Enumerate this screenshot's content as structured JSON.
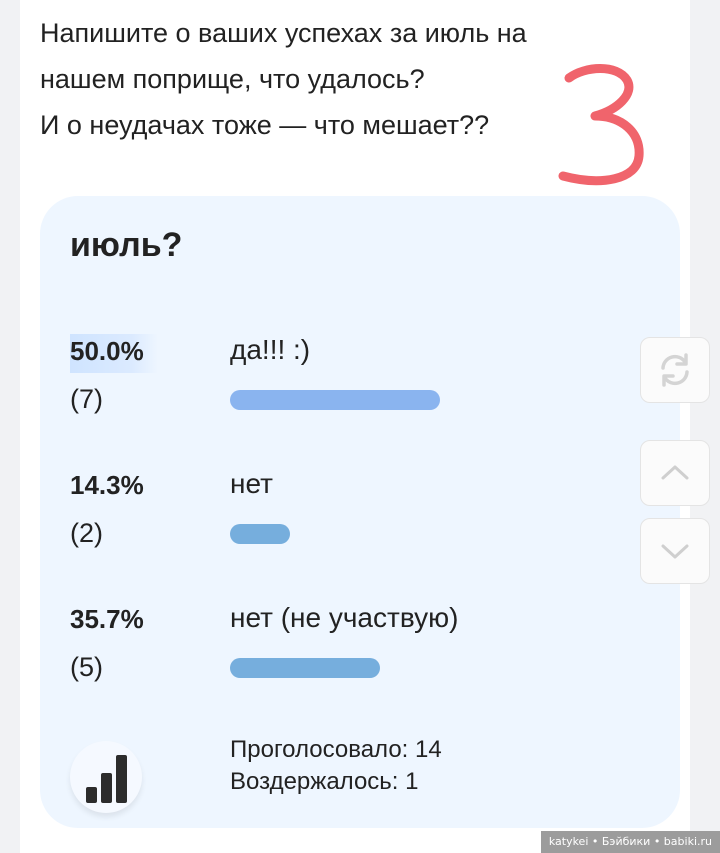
{
  "intro": {
    "lines": [
      "Напишите о ваших успехах за июль на",
      "нашем поприще, что удалось?",
      "И о неудачах тоже — что мешает??"
    ]
  },
  "handwritten_mark": "3",
  "poll": {
    "title": "июль?",
    "options": [
      {
        "percent": "50.0%",
        "count": "(7)",
        "label": "да!!! :)",
        "share": 0.5,
        "color": "#8ab4ef"
      },
      {
        "percent": "14.3%",
        "count": "(2)",
        "label": "нет",
        "share": 0.143,
        "color": "#76aedd"
      },
      {
        "percent": "35.7%",
        "count": "(5)",
        "label": "нет (не участвую)",
        "share": 0.357,
        "color": "#76aedd"
      }
    ],
    "voted": "Проголосовало: 14",
    "abstained": "Воздержалось: 1",
    "results_icon": "bar-chart-icon"
  },
  "side_buttons": [
    "refresh-icon",
    "chevron-up-icon",
    "chevron-down-icon"
  ],
  "watermark": "katykei • Бэйбики • babiki.ru"
}
